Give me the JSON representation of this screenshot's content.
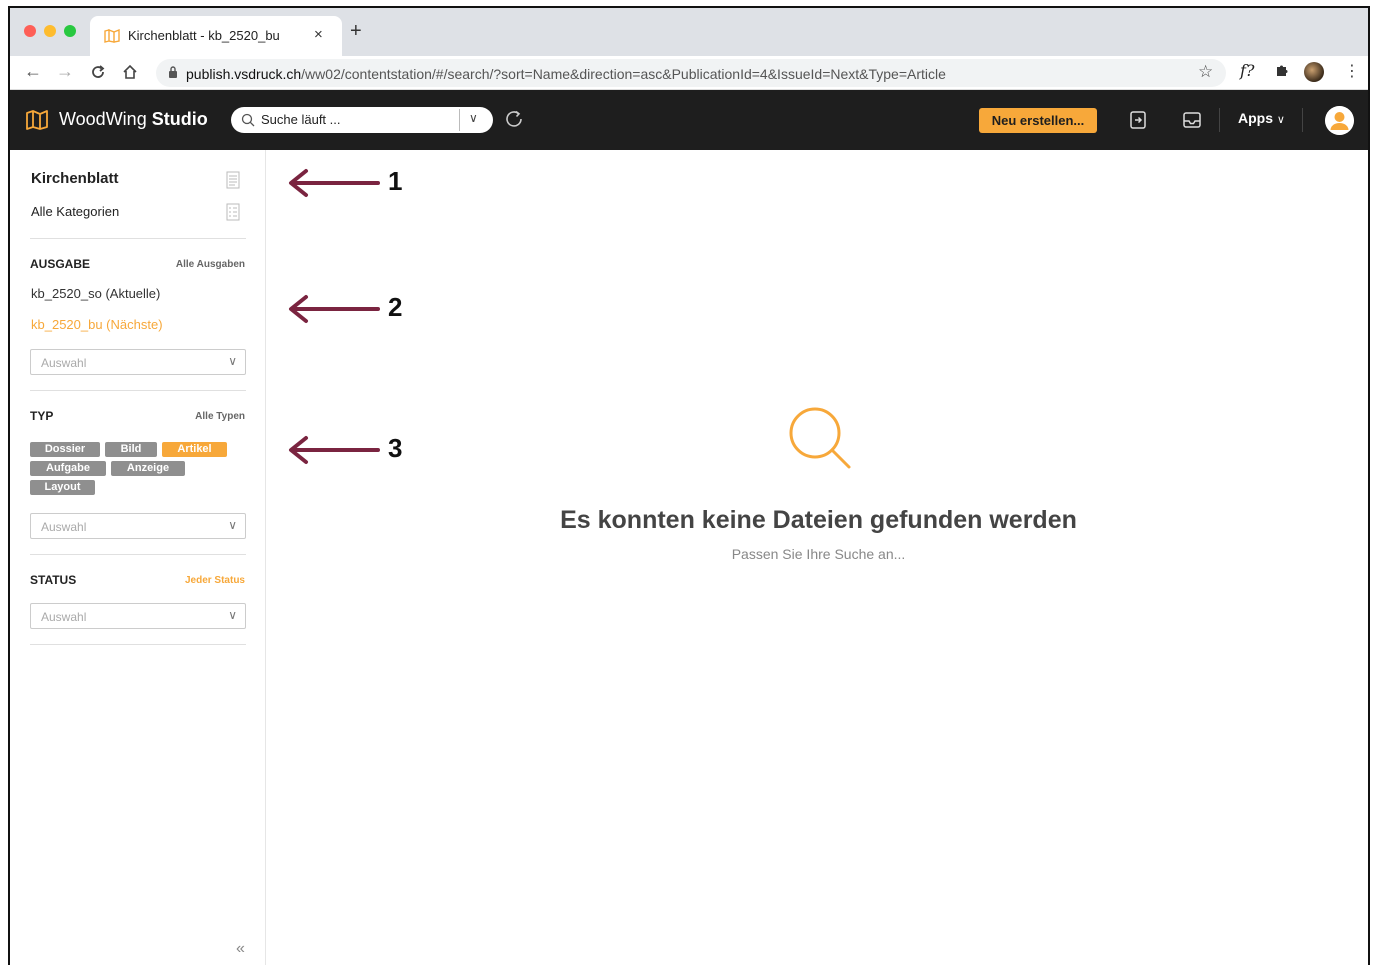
{
  "browser": {
    "tab_title": "Kirchenblatt - kb_2520_bu",
    "tab_close": "×",
    "new_tab": "+",
    "url_host": "publish.vsdruck.ch",
    "url_path": "/ww02/contentstation/#/search/?sort=Name&direction=asc&PublicationId=4&IssueId=Next&Type=Article",
    "ext_label": "f?"
  },
  "header": {
    "brand_light": "WoodWing",
    "brand_bold": "Studio",
    "search_value": "Suche läuft ...",
    "new_button": "Neu erstellen...",
    "apps_label": "Apps"
  },
  "sidebar": {
    "publication": "Kirchenblatt",
    "category": "Alle Kategorien",
    "issue_section": {
      "title": "AUSGABE",
      "link": "Alle Ausgaben",
      "items": [
        {
          "label": "kb_2520_so (Aktuelle)",
          "active": false
        },
        {
          "label": "kb_2520_bu (Nächste)",
          "active": true
        }
      ],
      "select_placeholder": "Auswahl"
    },
    "type_section": {
      "title": "TYP",
      "link": "Alle Typen",
      "chips": [
        {
          "label": "Dossier",
          "active": false
        },
        {
          "label": "Bild",
          "active": false
        },
        {
          "label": "Artikel",
          "active": true
        },
        {
          "label": "Aufgabe",
          "active": false
        },
        {
          "label": "Anzeige",
          "active": false
        },
        {
          "label": "Layout",
          "active": false
        }
      ],
      "select_placeholder": "Auswahl"
    },
    "status_section": {
      "title": "STATUS",
      "link": "Jeder Status",
      "select_placeholder": "Auswahl"
    },
    "collapse": "«"
  },
  "main": {
    "empty_title": "Es konnten keine Dateien gefunden werden",
    "empty_subtitle": "Passen Sie Ihre Suche an..."
  },
  "annotations": [
    "1",
    "2",
    "3"
  ],
  "colors": {
    "accent": "#f7a83a",
    "header_bg": "#1e1e1e",
    "chip_inactive": "#8f8f8f",
    "annotation_arrow": "#7a2440"
  }
}
